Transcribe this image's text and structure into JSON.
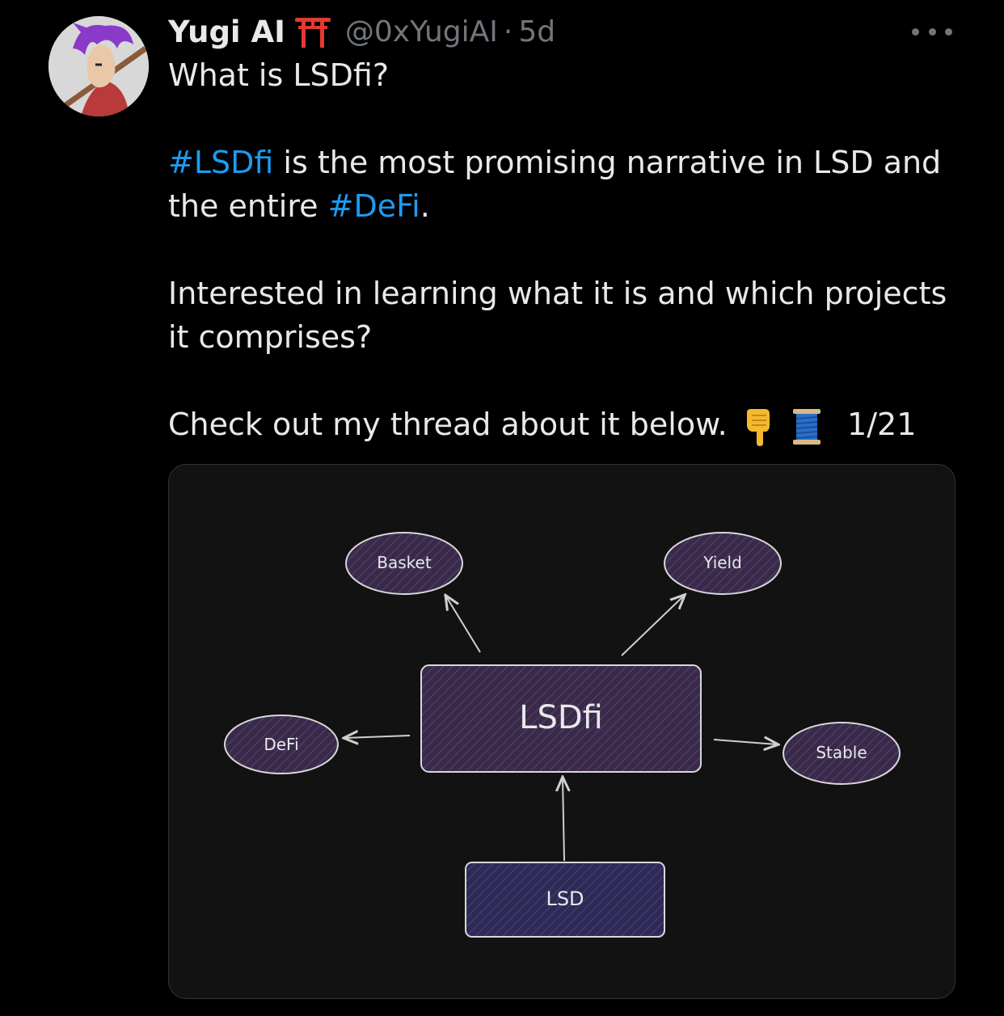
{
  "author": {
    "display_name": "Yugi AI",
    "handle": "@0xYugiAI",
    "separator": "·",
    "timestamp": "5d",
    "badge_icon": "torii-gate-icon"
  },
  "tweet": {
    "line1": "What is LSDfi?",
    "p2_tag1": "#LSDfi",
    "p2_text1": " is the most promising narrative in LSD and",
    "p2_text2": "the entire ",
    "p2_tag2": "#DeFi",
    "p2_text3": ".",
    "p3_line1": "Interested in learning what it is and which projects",
    "p3_line2": "it comprises?",
    "p4_text": "Check out my thread about it below.",
    "p4_count": "1/21"
  },
  "diagram": {
    "center": "LSDfi",
    "base": "LSD",
    "nodes": {
      "basket": "Basket",
      "yield": "Yield",
      "defi": "DeFi",
      "stable": "Stable"
    }
  },
  "colors": {
    "background": "#000000",
    "text": "#e7e9ea",
    "secondary": "#71767b",
    "hashtag": "#1d9bf0",
    "card_bg": "#121212",
    "node_fill": "#3a2a4a",
    "lsd_fill": "#2e2a55"
  }
}
